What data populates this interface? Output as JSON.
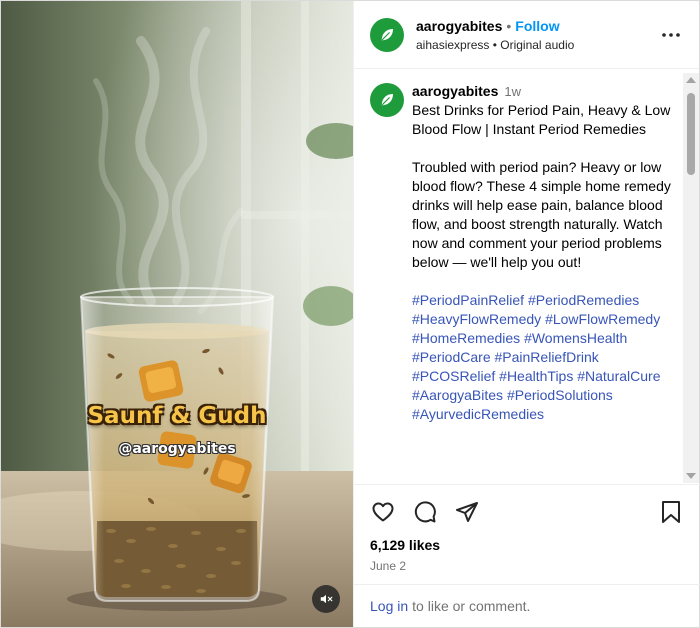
{
  "media": {
    "overlay_title": "Saunf & Gudh",
    "overlay_handle": "@aarogyabites"
  },
  "header": {
    "username": "aarogyabites",
    "separator": "•",
    "follow_label": "Follow",
    "subtitle": "aihasiexpress • Original audio"
  },
  "caption": {
    "username": "aarogyabites",
    "time": "1w",
    "title": "Best Drinks for Period Pain, Heavy & Low Blood Flow | Instant Period Remedies",
    "body": "Troubled with period pain? Heavy or low blood flow? These 4 simple home remedy drinks will help ease pain, balance blood flow, and boost strength naturally. Watch now and comment your period problems below — we'll help you out!",
    "hashtags": [
      "#PeriodPainRelief",
      "#PeriodRemedies",
      "#HeavyFlowRemedy",
      "#LowFlowRemedy",
      "#HomeRemedies",
      "#WomensHealth",
      "#PeriodCare",
      "#PainReliefDrink",
      "#PCOSRelief",
      "#HealthTips",
      "#NaturalCure",
      "#AarogyaBites",
      "#PeriodSolutions",
      "#AyurvedicRemedies"
    ]
  },
  "stats": {
    "likes": "6,129 likes",
    "date": "June 2"
  },
  "login": {
    "link": "Log in",
    "text": "to like or comment."
  },
  "icons": {
    "avatar": "leaf-icon",
    "more": "more-options-icon",
    "like": "heart-icon",
    "comment": "comment-icon",
    "share": "share-icon",
    "save": "bookmark-icon",
    "mute": "muted-speaker-icon"
  },
  "colors": {
    "accent": "#0095f6",
    "link": "#3855b8",
    "avatar_bg": "#1e9b3a",
    "overlay_title": "#f7c44a"
  }
}
